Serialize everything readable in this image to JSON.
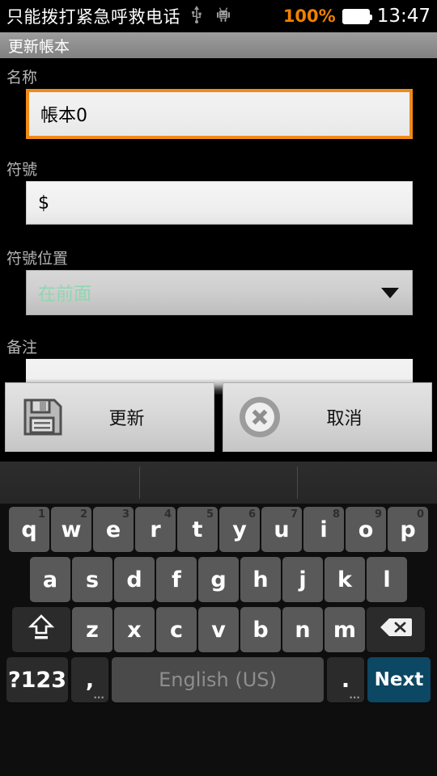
{
  "statusbar": {
    "carrier_text": "只能拨打紧急呼救电话",
    "usb_icon": "usb-icon",
    "bug_icon": "android-bug-icon",
    "battery_percent": "100%",
    "battery_icon": "battery-full-icon",
    "clock": "13:47",
    "accent_color": "#f08000"
  },
  "titlebar": {
    "title": "更新帳本"
  },
  "form": {
    "name": {
      "label": "名称",
      "value": "帳本0",
      "focused": true,
      "focus_color": "#f08a18"
    },
    "symbol": {
      "label": "符號",
      "value": "$"
    },
    "symbol_position": {
      "label": "符號位置",
      "value": "在前面",
      "value_color": "#8ed7b0",
      "dropdown_icon": "chevron-down-icon"
    },
    "note": {
      "label": "备注",
      "value": "",
      "placeholder": ""
    }
  },
  "actions": {
    "update": {
      "label": "更新",
      "icon": "save-floppy-icon"
    },
    "cancel": {
      "label": "取消",
      "icon": "cancel-circle-x-icon"
    }
  },
  "keyboard": {
    "suggestions": [
      "",
      "",
      ""
    ],
    "row1": [
      {
        "label": "q",
        "hint": "1"
      },
      {
        "label": "w",
        "hint": "2"
      },
      {
        "label": "e",
        "hint": "3"
      },
      {
        "label": "r",
        "hint": "4"
      },
      {
        "label": "t",
        "hint": "5"
      },
      {
        "label": "y",
        "hint": "6"
      },
      {
        "label": "u",
        "hint": "7"
      },
      {
        "label": "i",
        "hint": "8"
      },
      {
        "label": "o",
        "hint": "9"
      },
      {
        "label": "p",
        "hint": "0"
      }
    ],
    "row2": [
      {
        "label": "a"
      },
      {
        "label": "s"
      },
      {
        "label": "d"
      },
      {
        "label": "f"
      },
      {
        "label": "g"
      },
      {
        "label": "h"
      },
      {
        "label": "j"
      },
      {
        "label": "k"
      },
      {
        "label": "l"
      }
    ],
    "row3": {
      "shift": {
        "label": "",
        "icon": "shift-caps-icon"
      },
      "letters": [
        {
          "label": "z"
        },
        {
          "label": "x"
        },
        {
          "label": "c"
        },
        {
          "label": "v"
        },
        {
          "label": "b"
        },
        {
          "label": "n"
        },
        {
          "label": "m"
        }
      ],
      "backspace": {
        "label": "",
        "icon": "backspace-icon"
      }
    },
    "row4": {
      "symbols": {
        "label": "?123"
      },
      "comma": {
        "label": ",",
        "sub": "..."
      },
      "space": {
        "label": "English (US)"
      },
      "period": {
        "label": ".",
        "sub": "..."
      },
      "enter": {
        "label": "Next",
        "color": "#0c4763"
      }
    }
  }
}
